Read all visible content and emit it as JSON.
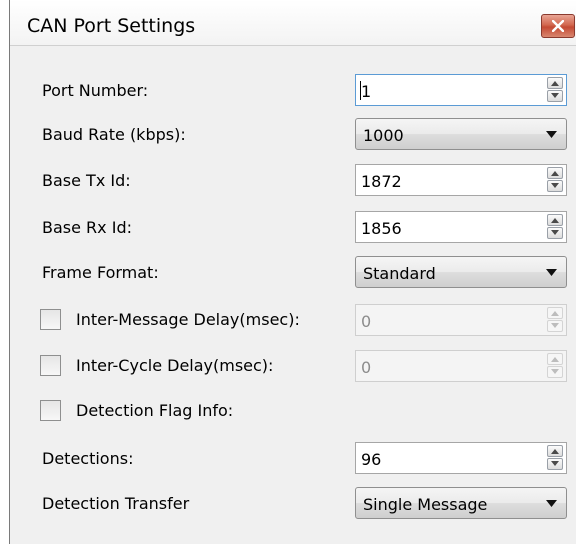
{
  "dialog": {
    "title": "CAN Port Settings",
    "close_icon": "close-x-icon",
    "close_color": "#c7452c"
  },
  "fields": {
    "port_number": {
      "label": "Port Number:",
      "value": "1"
    },
    "baud_rate": {
      "label": "Baud Rate (kbps):",
      "value": "1000"
    },
    "base_tx_id": {
      "label": "Base Tx Id:",
      "value": "1872"
    },
    "base_rx_id": {
      "label": "Base Rx Id:",
      "value": "1856"
    },
    "frame_format": {
      "label": "Frame Format:",
      "value": "Standard"
    },
    "inter_message_delay": {
      "label": "Inter-Message Delay(msec):",
      "value": "0",
      "checked": false,
      "enabled": false
    },
    "inter_cycle_delay": {
      "label": "Inter-Cycle Delay(msec):",
      "value": "0",
      "checked": false,
      "enabled": false
    },
    "detection_flag_info": {
      "label": "Detection Flag Info:",
      "checked": false
    },
    "detections": {
      "label": "Detections:",
      "value": "96"
    },
    "detection_transfer": {
      "label": "Detection Transfer",
      "value": "Single Message"
    }
  }
}
